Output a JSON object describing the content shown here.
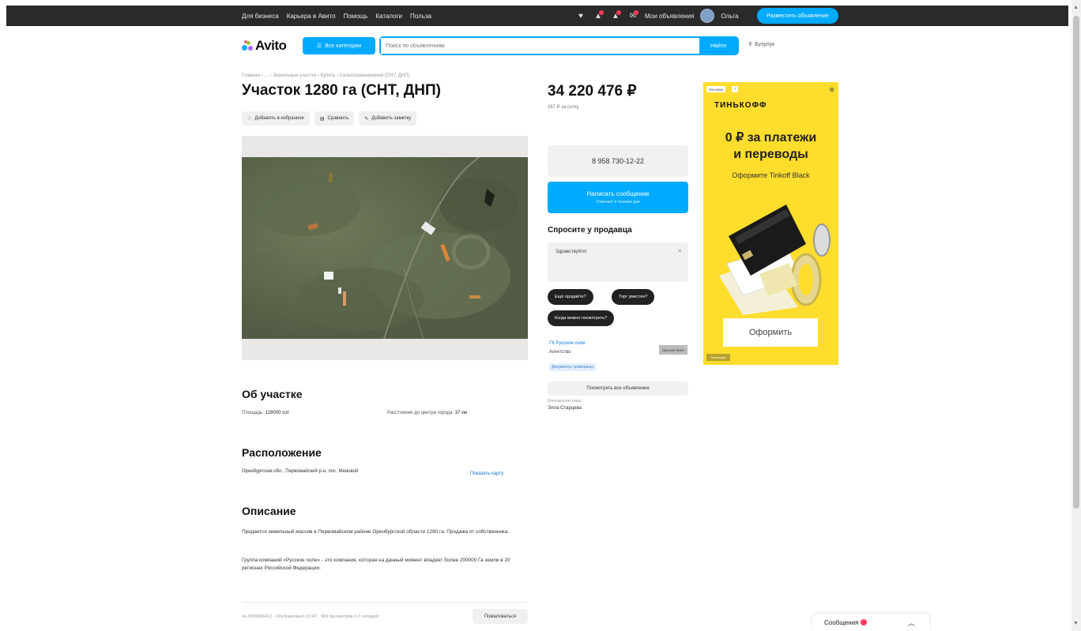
{
  "topbar": {
    "nav": [
      "Для бизнеса",
      "Карьера в Авито",
      "Помощь",
      "Каталоги",
      "Польза"
    ],
    "my_ads": "Мои объявления",
    "user": "Ольга",
    "post_button": "Разместить объявление"
  },
  "header": {
    "logo": "Avito",
    "categories_button": "Все категории",
    "search_placeholder": "Поиск по объявлениям",
    "search_button": "Найти",
    "location": "Бузулук"
  },
  "listing": {
    "breadcrumb": "Главная › … › Земельные участки › Купить › Сельхозназначения (СНТ, ДНП)",
    "title": "Участок 1280 га (СНТ, ДНП)",
    "actions": [
      "Добавить в избранное",
      "Сравнить",
      "Добавить заметку"
    ],
    "about_title": "Об участке",
    "area_label": "Площадь:",
    "area_value": "128000 сот",
    "distance_label": "Расстояние до центра города:",
    "distance_value": "37 км",
    "location_title": "Расположение",
    "address": "Оренбургская обл., Первомайский р-н, пос. Меновой",
    "show_map": "Показать карту",
    "description_title": "Описание",
    "description_p1": "Продается земельный массив в Первомайском районе Оренбургской области 1280 га. Продажа от собственника.",
    "description_p2": "Группа компаний «Русское поле» - это компания, которая на данный момент владеет более 200000 Га земли в 20 регионах Российской Федерации.",
    "footer_meta": "№ 3000466413 · Опубликовано 15:47 · 969 просмотров (+7 сегодня)",
    "complain_button": "Пожаловаться"
  },
  "sidebar": {
    "price": "34 220 476 ₽",
    "price_sub": "267 ₽ за сотку",
    "phone": "8 958 730-12-22",
    "message_button": "Написать сообщение",
    "message_sub": "Отвечает в течение дня",
    "ask_title": "Спросите у продавца",
    "ask_placeholder": "Здравствуйте!",
    "quick_questions": [
      "Ещё продаёте?",
      "Торг уместен?",
      "Когда можно посмотреть?"
    ],
    "seller_name": "ГК Русское поле",
    "seller_type": "Агентство",
    "seller_badge": "Документы проверены",
    "seller_logo": "русское поле",
    "other_ads": "Посмотреть все объявления",
    "contact_label": "Контактное лицо",
    "contact_name": "Элла Старцева"
  },
  "ad": {
    "tag": "Реклама",
    "brand": "ТИНЬКОФФ",
    "headline_1": "0 ₽ за платежи",
    "headline_2": "и переводы",
    "subline": "Оформите Tinkoff Black",
    "cta": "Оформить",
    "mini": "Тинькофф"
  },
  "messages_widget": {
    "label": "Сообщения"
  },
  "colors": {
    "accent": "#00aaff",
    "ad_yellow": "#ffdd2d",
    "link": "#0a74d6"
  }
}
